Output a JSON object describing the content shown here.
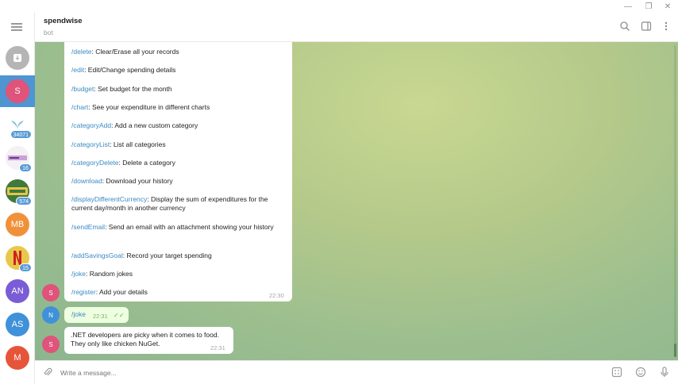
{
  "header": {
    "title": "spendwise",
    "subtitle": "bot"
  },
  "sidebar": {
    "chats": [
      {
        "initials": "",
        "color": "#b5b5b5",
        "badge": "",
        "icon": "archive-icon"
      },
      {
        "initials": "S",
        "color": "#e0537a",
        "badge": "",
        "active": true
      },
      {
        "initials": "",
        "color": "#ffffff",
        "badge": "34071",
        "icon": "plant-logo-icon"
      },
      {
        "initials": "",
        "color": "#ffffff",
        "badge": "16",
        "icon": "stock-image-icon"
      },
      {
        "initials": "",
        "color": "#3f7a3c",
        "badge": "574",
        "icon": "stocks-logo-icon"
      },
      {
        "initials": "MB",
        "color": "#f0913a"
      },
      {
        "initials": "",
        "color": "#d02020",
        "badge": "15",
        "icon": "netflix-logo-icon"
      },
      {
        "initials": "AN",
        "color": "#7a5cd6"
      },
      {
        "initials": "AS",
        "color": "#3f91d9"
      },
      {
        "initials": "M",
        "color": "#e6553a"
      }
    ]
  },
  "commands": [
    {
      "cmd": "/delete",
      "desc": ": Clear/Erase all your records"
    },
    {
      "cmd": "/edit",
      "desc": ": Edit/Change spending details"
    },
    {
      "cmd": "/budget",
      "desc": ": Set budget for the month"
    },
    {
      "cmd": "/chart",
      "desc": ": See your expenditure in different charts"
    },
    {
      "cmd": "/categoryAdd",
      "desc": ": Add a new custom category"
    },
    {
      "cmd": "/categoryList",
      "desc": ": List all categories"
    },
    {
      "cmd": "/categoryDelete",
      "desc": ": Delete a category"
    },
    {
      "cmd": "/download",
      "desc": ": Download your history"
    },
    {
      "cmd": "/displayDifferentCurrency",
      "desc": ": Display the sum of expenditures for the current day/month in another currency"
    },
    {
      "cmd": "/sendEmail",
      "desc": ": Send an email with an attachment showing your history"
    },
    {
      "cmd": "/addSavingsGoal",
      "desc": ": Record your target spending"
    },
    {
      "cmd": "/joke",
      "desc": ": Random jokes"
    },
    {
      "cmd": "/register",
      "desc": ": Add your details"
    }
  ],
  "messages": {
    "cmdlist_time": "22:30",
    "cmdlist_avatar": "S",
    "user_msg": "/joke",
    "user_time": "22:31",
    "user_avatar": "N",
    "bot_reply": ".NET developers are picky when it comes to food. They only like chicken NuGet.",
    "bot_time": "22:31",
    "bot_avatar": "S"
  },
  "composer": {
    "placeholder": "Write a message..."
  },
  "colors": {
    "link": "#3a8ac4",
    "accent": "#4f95d2"
  }
}
